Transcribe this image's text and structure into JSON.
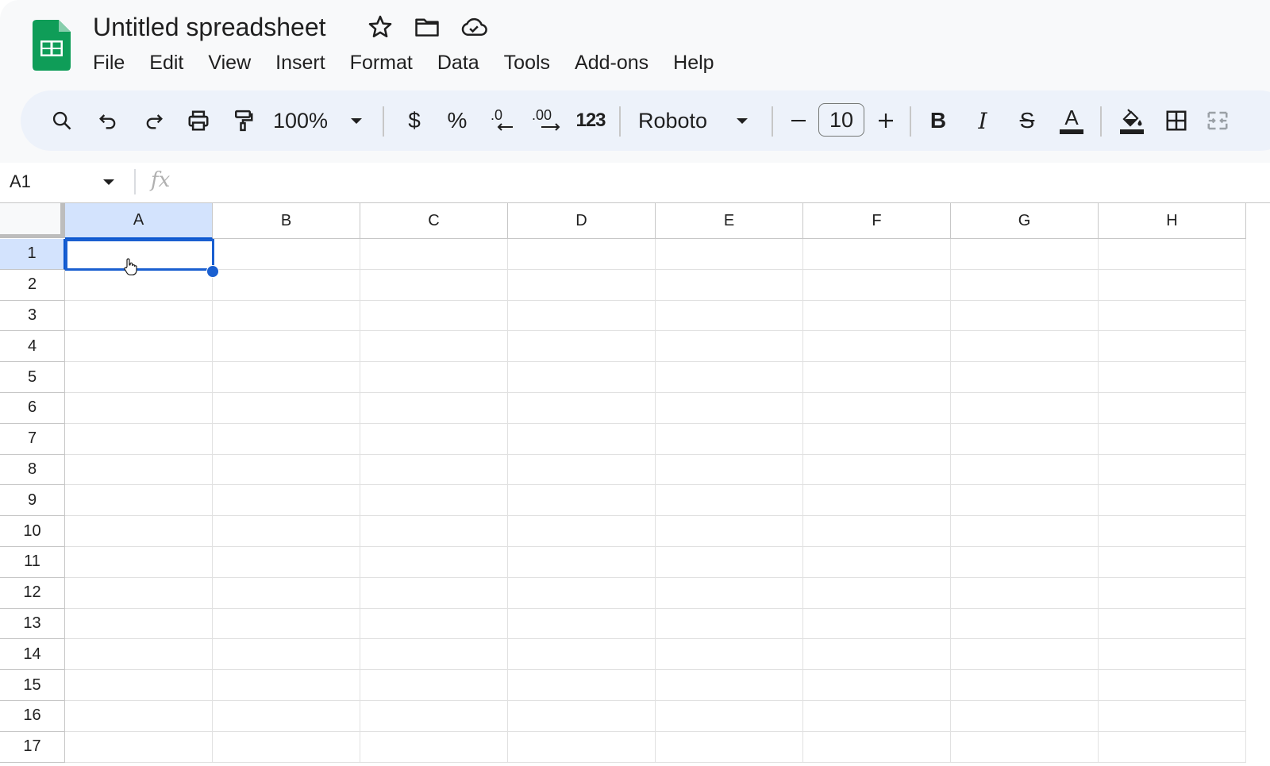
{
  "doc": {
    "title": "Untitled spreadsheet",
    "icons": [
      "star-icon",
      "folder-icon",
      "cloud-saved-icon"
    ]
  },
  "menu": [
    "File",
    "Edit",
    "View",
    "Insert",
    "Format",
    "Data",
    "Tools",
    "Add-ons",
    "Help"
  ],
  "toolbar": {
    "zoom": "100%",
    "currency": "$",
    "percent": "%",
    "decrease_decimal": ".0",
    "increase_decimal": ".00",
    "number_format": "123",
    "font": "Roboto",
    "font_size": "10",
    "minus": "—",
    "plus": "+",
    "bold": "B",
    "italic": "I",
    "strike": "S",
    "text_color": "A"
  },
  "formula_bar": {
    "name_box": "A1",
    "fx": "fx",
    "value": ""
  },
  "sheet": {
    "columns": [
      "A",
      "B",
      "C",
      "D",
      "E",
      "F",
      "G",
      "H"
    ],
    "rows": [
      "1",
      "2",
      "3",
      "4",
      "5",
      "6",
      "7",
      "8",
      "9",
      "10",
      "11",
      "12",
      "13",
      "14",
      "15",
      "16",
      "17"
    ],
    "selected_cell": "A1",
    "selected_column": "A",
    "selected_row": "1"
  },
  "colors": {
    "accent": "#0b57d0",
    "toolbar_bg": "#edf2fa",
    "selection_bg": "#d3e3fd",
    "sheets_green": "#0f9d58"
  }
}
